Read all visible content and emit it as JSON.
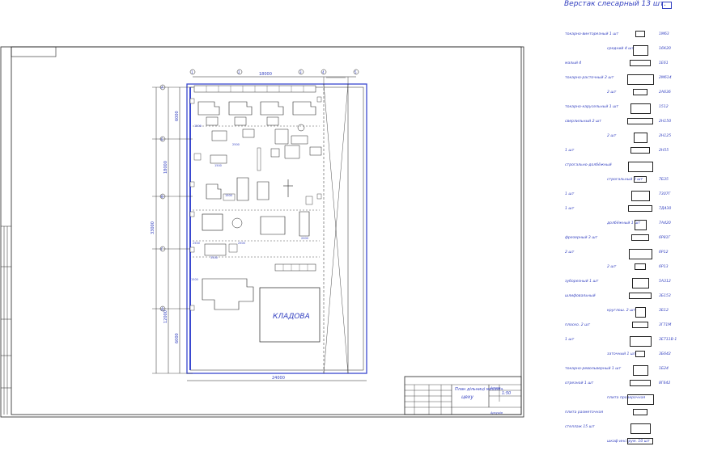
{
  "drawing": {
    "storeroom_label": "КЛАДОВА",
    "overall_width_dim": "24000",
    "overall_height_dim": "33000",
    "top_dim": "18000",
    "side_dims": [
      "6000",
      "6000",
      "18000",
      "6000",
      "12000",
      "6000"
    ],
    "grid_markers": [
      "А",
      "Б",
      "В",
      "Г",
      "Д",
      "1",
      "2",
      "3",
      "4",
      "5"
    ],
    "inner_dims": [
      "1500",
      "2500",
      "1500",
      "1500",
      "2500",
      "2500",
      "3500",
      "1500",
      "2000",
      "2500",
      "1500",
      "1500",
      "1500",
      "2500"
    ]
  },
  "title_block": {
    "title": "План дільниці механіч.",
    "subtitle": "цеху",
    "sheet_label": "Аркуш",
    "sheets_label": "Аркушів",
    "scale": "1:50",
    "rows": [
      "Зм.",
      "Арк.",
      "№ докум.",
      "Підп.",
      "Дата",
      "Розроб.",
      "Перевір.",
      "Т.контр.",
      "Н.контр.",
      "Затв."
    ]
  },
  "legend": {
    "header": "Верстак слесарный  13 шт.",
    "items": [
      {
        "name": "токарно-винторезный  1 шт",
        "model": "1М63"
      },
      {
        "name": "средний  4 шт",
        "model": "16К20"
      },
      {
        "name": "малый  4",
        "model": "1Е61"
      },
      {
        "name": "токарно-расточный  2 шт",
        "model": "2М614"
      },
      {
        "name": "2 шт",
        "model": "2А636"
      },
      {
        "name": "токарно-карусельный  1 шт",
        "model": "1512"
      },
      {
        "name": "сверлильный  2 шт",
        "model": "2Н150"
      },
      {
        "name": "2 шт",
        "model": "2Н125"
      },
      {
        "name": "1 шт",
        "model": "2Н55"
      },
      {
        "name": "строгально-долбёжный",
        "model": ""
      },
      {
        "name": "строгальный  2 шт",
        "model": "7Б35"
      },
      {
        "name": "1 шт",
        "model": "7307Г"
      },
      {
        "name": "1 шт",
        "model": "7Д430"
      },
      {
        "name": "долбёжный  1 шт",
        "model": "7А420"
      },
      {
        "name": "фрезерный  3 шт",
        "model": "6Р81Г"
      },
      {
        "name": "2 шт",
        "model": "6Р12"
      },
      {
        "name": "2 шт",
        "model": "6Р13"
      },
      {
        "name": "зуборезный  1 шт",
        "model": "5А312"
      },
      {
        "name": "шлифовальный",
        "model": "3Б153"
      },
      {
        "name": "круглош.  2 шт",
        "model": "3Б12"
      },
      {
        "name": "плоско.  2 шт",
        "model": "3Г71М"
      },
      {
        "name": "1 шт",
        "model": "3Е711В-1"
      },
      {
        "name": "заточный  1 шт",
        "model": "3Б642"
      },
      {
        "name": "токарно-револьверный  1 шт",
        "model": "1Б24"
      },
      {
        "name": "отрезной  1 шт",
        "model": "8Г642"
      },
      {
        "name": "плита проверочная",
        "model": ""
      },
      {
        "name": "плита разметочная",
        "model": ""
      },
      {
        "name": "стеллаж  15 шт",
        "model": ""
      },
      {
        "name": "шкаф инструм.  10 шт",
        "model": ""
      }
    ]
  },
  "colors": {
    "line": "#222222",
    "accent": "#3a49d0",
    "background": "#ffffff"
  }
}
